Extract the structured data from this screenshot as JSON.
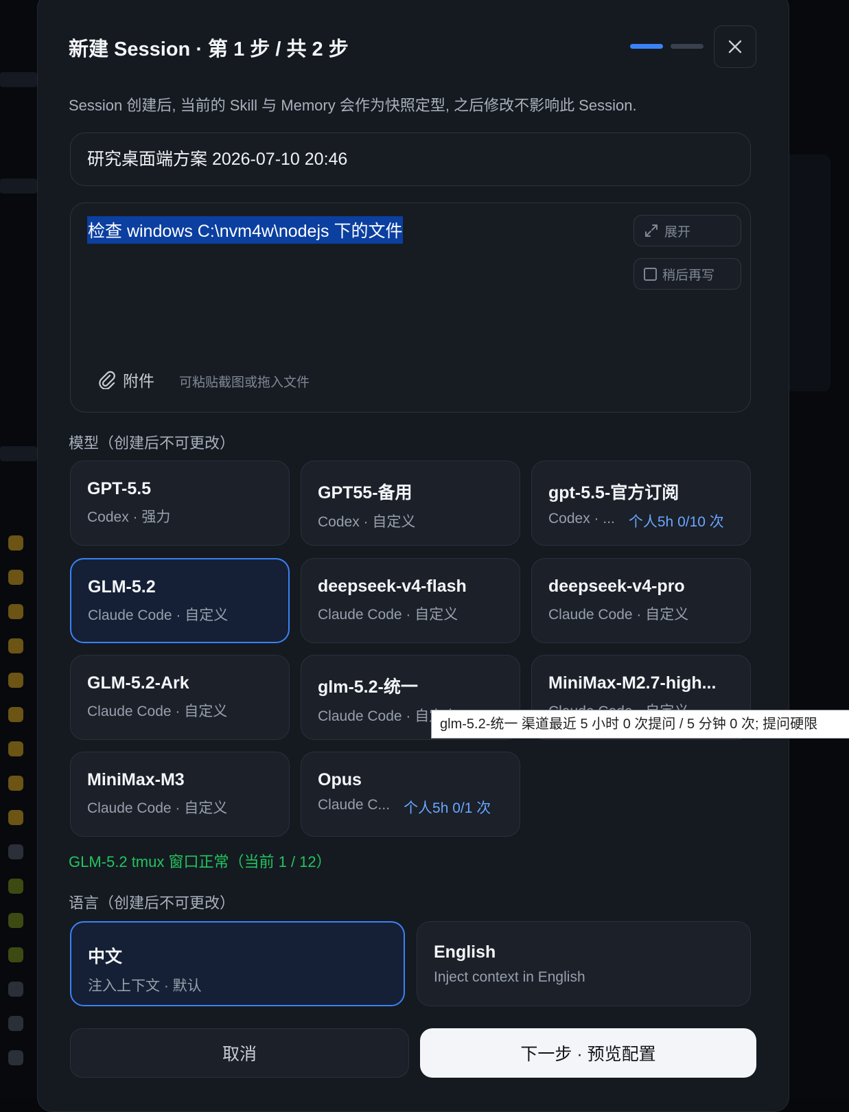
{
  "dialog": {
    "title": "新建 Session · 第 1 步 / 共 2 步",
    "subtitle": "Session 创建后, 当前的 Skill 与 Memory 会作为快照定型, 之后修改不影响此 Session."
  },
  "session_name": {
    "value": "研究桌面端方案 2026-07-10 20:46"
  },
  "prompt": {
    "value": "检查 windows C:\\nvm4w\\nodejs 下的文件",
    "expand_label": "展开",
    "later_label": "稍后再写",
    "attach_label": "附件",
    "attach_hint": "可粘贴截图或拖入文件"
  },
  "models": {
    "label": "模型（创建后不可更改）",
    "items": [
      {
        "name": "GPT-5.5",
        "meta": "Codex · 强力",
        "quota": ""
      },
      {
        "name": "GPT55-备用",
        "meta": "Codex · 自定义",
        "quota": ""
      },
      {
        "name": "gpt-5.5-官方订阅",
        "meta": "Codex · ...",
        "quota": "个人5h 0/10 次"
      },
      {
        "name": "GLM-5.2",
        "meta": "Claude Code · 自定义",
        "quota": ""
      },
      {
        "name": "deepseek-v4-flash",
        "meta": "Claude Code · 自定义",
        "quota": ""
      },
      {
        "name": "deepseek-v4-pro",
        "meta": "Claude Code · 自定义",
        "quota": ""
      },
      {
        "name": "GLM-5.2-Ark",
        "meta": "Claude Code · 自定义",
        "quota": ""
      },
      {
        "name": "glm-5.2-统一",
        "meta": "Claude Code · 自定义",
        "quota": ""
      },
      {
        "name": "MiniMax-M2.7-high...",
        "meta": "Claude Code · 自定义",
        "quota": ""
      },
      {
        "name": "MiniMax-M3",
        "meta": "Claude Code · 自定义",
        "quota": ""
      },
      {
        "name": "Opus",
        "meta": "Claude C...",
        "quota": "个人5h 0/1 次"
      }
    ],
    "selected": "GLM-5.2",
    "tooltip": "glm-5.2-统一 渠道最近 5 小时 0 次提问 / 5 分钟 0 次; 提问硬限"
  },
  "status": {
    "text": "GLM-5.2 tmux 窗口正常（当前 1 / 12）"
  },
  "language": {
    "label": "语言（创建后不可更改）",
    "items": [
      {
        "name": "中文",
        "desc": "注入上下文 · 默认"
      },
      {
        "name": "English",
        "desc": "Inject context in English"
      }
    ],
    "selected": "中文"
  },
  "footer": {
    "cancel_label": "取消",
    "next_label": "下一步 · 预览配置"
  },
  "colors": {
    "accent": "#3b82f6",
    "status_ok": "#22c55e",
    "quota": "#6aa6ff",
    "selection": "#0b3fa0"
  },
  "icons": {
    "close": "close-icon",
    "expand": "expand-icon",
    "attach": "paperclip-icon"
  }
}
